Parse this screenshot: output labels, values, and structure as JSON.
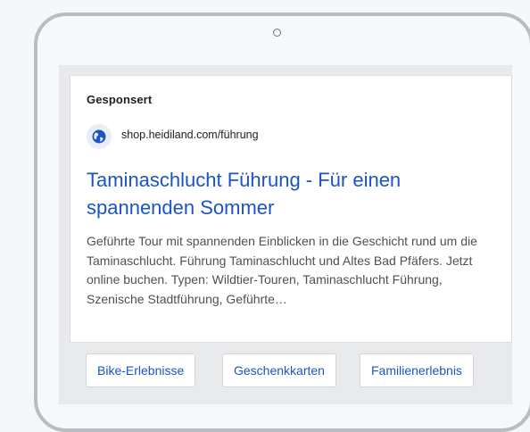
{
  "ad": {
    "sponsored_label": "Gesponsert",
    "favicon": "globe-icon",
    "display_url": "shop.heidiland.com/führung",
    "headline": "Taminaschlucht Führung - Für einen spannenden Sommer",
    "description": "Geführte Tour mit spannenden Einblicken in die Geschicht rund um die Taminaschlucht. Führung Taminaschlucht und Altes Bad Pfäfers. Jetzt online buchen. Typen: Wildtier-Touren, Taminaschlucht Führung, Szenische Stadtführung, Geführte…"
  },
  "sitelinks": [
    {
      "label": "Bike-Erlebnisse"
    },
    {
      "label": "Geschenkkarten"
    },
    {
      "label": "Familienerlebnis"
    }
  ],
  "colors": {
    "link": "#1a55c6",
    "text": "#202124",
    "description": "#4d5156",
    "favicon_bg": "#e9eef6",
    "phone_frame": "#b9bdc1"
  }
}
